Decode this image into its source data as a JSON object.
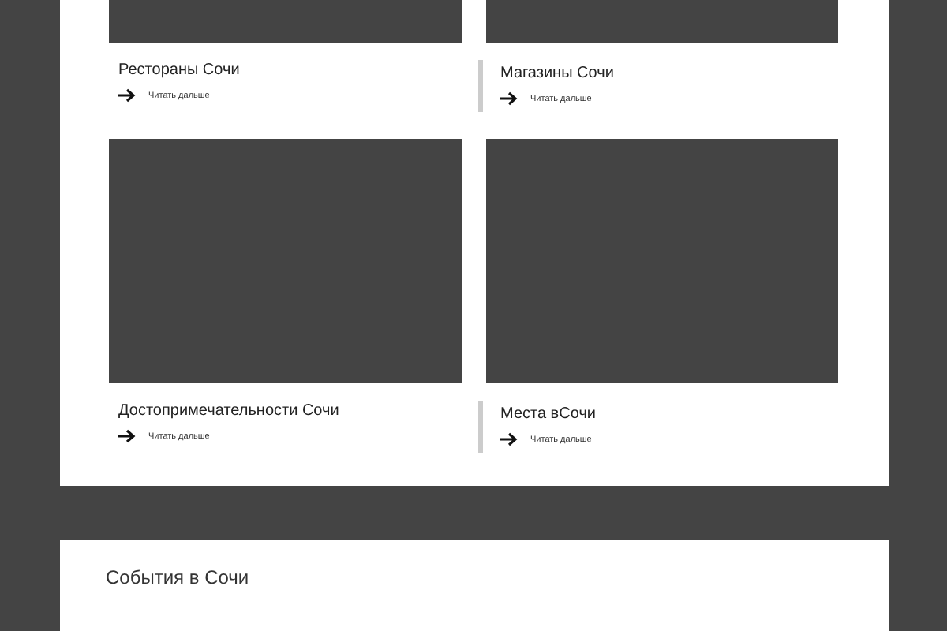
{
  "cards": [
    {
      "title": "Рестораны Сочи",
      "link": "Читать дальше",
      "highlighted": false
    },
    {
      "title": "Магазины Сочи",
      "link": "Читать дальше",
      "highlighted": true
    },
    {
      "title": "Достопримечательности Сочи",
      "link": "Читать дальше",
      "highlighted": false
    },
    {
      "title": "Места вСочи",
      "link": "Читать дальше",
      "highlighted": true
    }
  ],
  "events": {
    "title": "События в Сочи"
  }
}
